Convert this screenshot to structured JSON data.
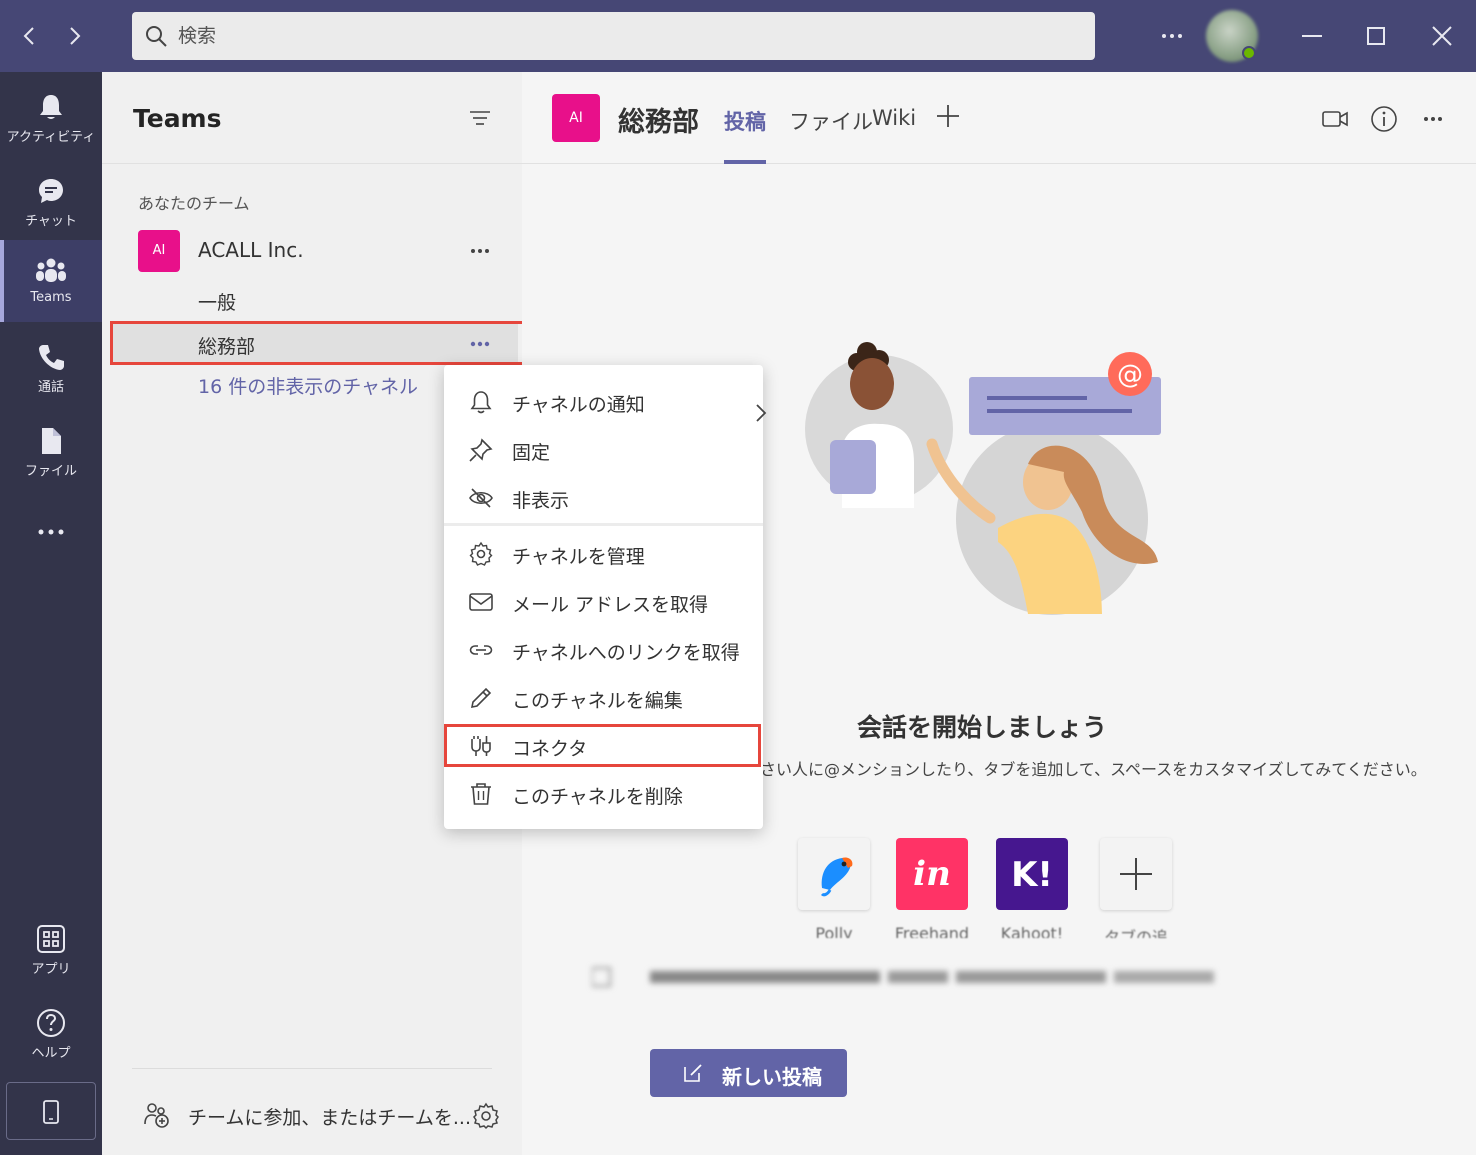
{
  "titlebar": {
    "search_placeholder": "検索",
    "back_icon": "chevron-left-icon",
    "forward_icon": "chevron-right-icon",
    "more_icon": "more-horizontal-icon",
    "minimize_icon": "minimize-icon",
    "maximize_icon": "maximize-icon",
    "close_icon": "close-icon"
  },
  "rail": {
    "items": [
      {
        "label": "アクティビティ",
        "icon": "bell-icon"
      },
      {
        "label": "チャット",
        "icon": "chat-icon"
      },
      {
        "label": "Teams",
        "icon": "teams-icon"
      },
      {
        "label": "通話",
        "icon": "phone-icon"
      },
      {
        "label": "ファイル",
        "icon": "file-icon"
      }
    ],
    "bottom": [
      {
        "label": "アプリ",
        "icon": "apps-icon"
      },
      {
        "label": "ヘルプ",
        "icon": "help-icon"
      }
    ],
    "active": "Teams"
  },
  "panel": {
    "title": "Teams",
    "section_label": "あなたのチーム",
    "team": {
      "avatar": "AI",
      "name": "ACALL Inc."
    },
    "channels": [
      "一般",
      "総務部"
    ],
    "hidden_channels": "16 件の非表示のチャネル",
    "join_label": "チームに参加、またはチームを..."
  },
  "main": {
    "channel_avatar": "AI",
    "channel_title": "総務部",
    "tabs": [
      "投稿",
      "ファイル",
      "Wiki"
    ],
    "active_tab": "投稿",
    "headline": "会話を開始しましょう",
    "subline": "さい人に@メンションしたり、タブを追加して、スペースをカスタマイズしてみてください。",
    "apps": [
      {
        "name": "Polly",
        "color": "#f3f3f3"
      },
      {
        "name": "Freehand",
        "color": "#ff3366"
      },
      {
        "name": "Kahoot!",
        "color": "#46178f"
      },
      {
        "name": "タブの追",
        "color": "#f3f3f3"
      }
    ],
    "new_post_label": "新しい投稿"
  },
  "context_menu": {
    "items": [
      {
        "label": "チャネルの通知",
        "icon": "bell-icon"
      },
      {
        "label": "固定",
        "icon": "pin-icon"
      },
      {
        "label": "非表示",
        "icon": "eye-off-icon"
      },
      {
        "label": "チャネルを管理",
        "icon": "gear-icon"
      },
      {
        "label": "メール アドレスを取得",
        "icon": "mail-icon"
      },
      {
        "label": "チャネルへのリンクを取得",
        "icon": "link-icon"
      },
      {
        "label": "このチャネルを編集",
        "icon": "pencil-icon"
      },
      {
        "label": "コネクタ",
        "icon": "connector-icon"
      },
      {
        "label": "このチャネルを削除",
        "icon": "trash-icon"
      }
    ]
  },
  "colors": {
    "titlebar": "#464775",
    "rail": "#33344a",
    "accent": "#6264a7",
    "team_avatar": "#e8108a",
    "highlight_box": "#e6463c"
  }
}
